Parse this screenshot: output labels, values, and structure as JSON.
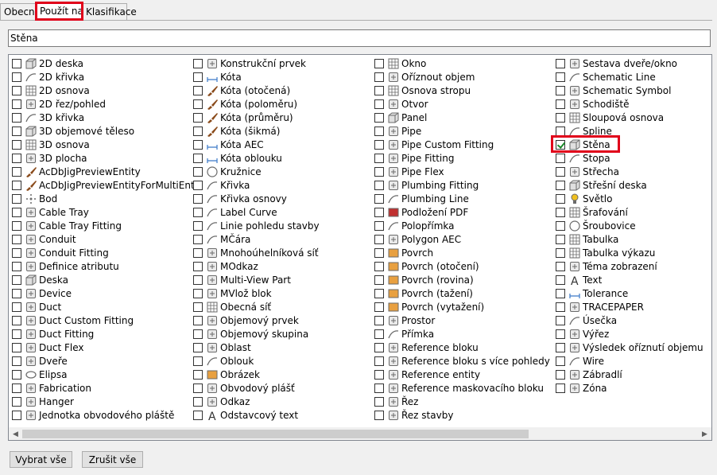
{
  "tabs": [
    {
      "label": "Obecné",
      "active": false
    },
    {
      "label": "Použít na",
      "active": true
    },
    {
      "label": "Klasifikace",
      "active": false
    }
  ],
  "name_field": {
    "value": "Stěna"
  },
  "columns": [
    [
      {
        "label": "2D deska",
        "icon": "slab-2d-icon",
        "checked": false
      },
      {
        "label": "2D křivka",
        "icon": "curve-2d-icon",
        "checked": false
      },
      {
        "label": "2D osnova",
        "icon": "grid-2d-icon",
        "checked": false
      },
      {
        "label": "2D řez/pohled",
        "icon": "section-2d-icon",
        "checked": false
      },
      {
        "label": "3D křivka",
        "icon": "curve-3d-icon",
        "checked": false
      },
      {
        "label": "3D objemové těleso",
        "icon": "solid-3d-icon",
        "checked": false
      },
      {
        "label": "3D osnova",
        "icon": "grid-3d-icon",
        "checked": false
      },
      {
        "label": "3D plocha",
        "icon": "face-3d-icon",
        "checked": false
      },
      {
        "label": "AcDbJigPreviewEntity",
        "icon": "brush-icon",
        "checked": false
      },
      {
        "label": "AcDbJigPreviewEntityForMultiEnts",
        "icon": "brush-icon",
        "checked": false
      },
      {
        "label": "Bod",
        "icon": "point-icon",
        "checked": false
      },
      {
        "label": "Cable Tray",
        "icon": "cable-tray-icon",
        "checked": false
      },
      {
        "label": "Cable Tray Fitting",
        "icon": "cable-tray-fitting-icon",
        "checked": false
      },
      {
        "label": "Conduit",
        "icon": "conduit-icon",
        "checked": false
      },
      {
        "label": "Conduit Fitting",
        "icon": "conduit-fitting-icon",
        "checked": false
      },
      {
        "label": "Definice atributu",
        "icon": "attribute-icon",
        "checked": false
      },
      {
        "label": "Deska",
        "icon": "slab-icon",
        "checked": false
      },
      {
        "label": "Device",
        "icon": "device-icon",
        "checked": false
      },
      {
        "label": "Duct",
        "icon": "duct-icon",
        "checked": false
      },
      {
        "label": "Duct Custom Fitting",
        "icon": "duct-custom-fitting-icon",
        "checked": false
      },
      {
        "label": "Duct Fitting",
        "icon": "duct-fitting-icon",
        "checked": false
      },
      {
        "label": "Duct Flex",
        "icon": "duct-flex-icon",
        "checked": false
      },
      {
        "label": "Dveře",
        "icon": "door-icon",
        "checked": false
      },
      {
        "label": "Elipsa",
        "icon": "ellipse-icon",
        "checked": false
      },
      {
        "label": "Fabrication",
        "icon": "fabrication-icon",
        "checked": false
      },
      {
        "label": "Hanger",
        "icon": "hanger-icon",
        "checked": false
      },
      {
        "label": "Jednotka obvodového pláště",
        "icon": "curtain-wall-unit-icon",
        "checked": false
      }
    ],
    [
      {
        "label": "Konstrukční prvek",
        "icon": "structural-member-icon",
        "checked": false
      },
      {
        "label": "Kóta",
        "icon": "dimension-icon",
        "checked": false
      },
      {
        "label": "Kóta (otočená)",
        "icon": "brush-icon",
        "checked": false
      },
      {
        "label": "Kóta (poloměru)",
        "icon": "brush-icon",
        "checked": false
      },
      {
        "label": "Kóta (průměru)",
        "icon": "brush-icon",
        "checked": false
      },
      {
        "label": "Kóta (šikmá)",
        "icon": "brush-icon",
        "checked": false
      },
      {
        "label": "Kóta AEC",
        "icon": "aec-dimension-icon",
        "checked": false
      },
      {
        "label": "Kóta oblouku",
        "icon": "arc-dimension-icon",
        "checked": false
      },
      {
        "label": "Kružnice",
        "icon": "circle-icon",
        "checked": false
      },
      {
        "label": "Křivka",
        "icon": "polyline-icon",
        "checked": false
      },
      {
        "label": "Křivka osnovy",
        "icon": "grid-line-icon",
        "checked": false
      },
      {
        "label": "Label Curve",
        "icon": "label-curve-icon",
        "checked": false
      },
      {
        "label": "Linie pohledu stavby",
        "icon": "building-line-icon",
        "checked": false
      },
      {
        "label": "MČára",
        "icon": "mline-icon",
        "checked": false
      },
      {
        "label": "Mnohoúhelníková síť",
        "icon": "polygon-mesh-icon",
        "checked": false
      },
      {
        "label": "MOdkaz",
        "icon": "mleader-icon",
        "checked": false
      },
      {
        "label": "Multi-View Part",
        "icon": "multi-view-part-icon",
        "checked": false
      },
      {
        "label": "MVlož blok",
        "icon": "minsert-block-icon",
        "checked": false
      },
      {
        "label": "Obecná síť",
        "icon": "mesh-icon",
        "checked": false
      },
      {
        "label": "Objemový prvek",
        "icon": "mass-element-icon",
        "checked": false
      },
      {
        "label": "Objemový skupina",
        "icon": "mass-group-icon",
        "checked": false
      },
      {
        "label": "Oblast",
        "icon": "region-icon",
        "checked": false
      },
      {
        "label": "Oblouk",
        "icon": "arc-icon",
        "checked": false
      },
      {
        "label": "Obrázek",
        "icon": "image-icon",
        "checked": false
      },
      {
        "label": "Obvodový plášť",
        "icon": "curtain-wall-icon",
        "checked": false
      },
      {
        "label": "Odkaz",
        "icon": "leader-icon",
        "checked": false
      },
      {
        "label": "Odstavcový text",
        "icon": "mtext-icon",
        "checked": false
      }
    ],
    [
      {
        "label": "Okno",
        "icon": "window-icon",
        "checked": false
      },
      {
        "label": "Oříznout objem",
        "icon": "clip-volume-icon",
        "checked": false
      },
      {
        "label": "Osnova stropu",
        "icon": "ceiling-grid-icon",
        "checked": false
      },
      {
        "label": "Otvor",
        "icon": "opening-icon",
        "checked": false
      },
      {
        "label": "Panel",
        "icon": "panel-icon",
        "checked": false
      },
      {
        "label": "Pipe",
        "icon": "pipe-icon",
        "checked": false
      },
      {
        "label": "Pipe Custom Fitting",
        "icon": "pipe-custom-fitting-icon",
        "checked": false
      },
      {
        "label": "Pipe Fitting",
        "icon": "pipe-fitting-icon",
        "checked": false
      },
      {
        "label": "Pipe Flex",
        "icon": "pipe-flex-icon",
        "checked": false
      },
      {
        "label": "Plumbing Fitting",
        "icon": "plumbing-fitting-icon",
        "checked": false
      },
      {
        "label": "Plumbing Line",
        "icon": "plumbing-line-icon",
        "checked": false
      },
      {
        "label": "Podložení PDF",
        "icon": "pdf-underlay-icon",
        "checked": false
      },
      {
        "label": "Polopřímka",
        "icon": "ray-icon",
        "checked": false
      },
      {
        "label": "Polygon AEC",
        "icon": "aec-polygon-icon",
        "checked": false
      },
      {
        "label": "Povrch",
        "icon": "surface-icon",
        "checked": false
      },
      {
        "label": "Povrch (otočení)",
        "icon": "revolved-surface-icon",
        "checked": false
      },
      {
        "label": "Povrch (rovina)",
        "icon": "planar-surface-icon",
        "checked": false
      },
      {
        "label": "Povrch (tažení)",
        "icon": "swept-surface-icon",
        "checked": false
      },
      {
        "label": "Povrch (vytažení)",
        "icon": "extruded-surface-icon",
        "checked": false
      },
      {
        "label": "Prostor",
        "icon": "space-icon",
        "checked": false
      },
      {
        "label": "Přímka",
        "icon": "xline-icon",
        "checked": false
      },
      {
        "label": "Reference bloku",
        "icon": "block-reference-icon",
        "checked": false
      },
      {
        "label": "Reference bloku s více pohledy",
        "icon": "multi-view-block-icon",
        "checked": false
      },
      {
        "label": "Reference entity",
        "icon": "entity-reference-icon",
        "checked": false
      },
      {
        "label": "Reference maskovacího bloku",
        "icon": "mask-block-icon",
        "checked": false
      },
      {
        "label": "Řez",
        "icon": "section-icon",
        "checked": false
      },
      {
        "label": "Řez stavby",
        "icon": "building-section-icon",
        "checked": false
      }
    ],
    [
      {
        "label": "Sestava dveře/okno",
        "icon": "door-window-assembly-icon",
        "checked": false
      },
      {
        "label": "Schematic Line",
        "icon": "schematic-line-icon",
        "checked": false
      },
      {
        "label": "Schematic Symbol",
        "icon": "schematic-symbol-icon",
        "checked": false
      },
      {
        "label": "Schodiště",
        "icon": "stair-icon",
        "checked": false
      },
      {
        "label": "Sloupová osnova",
        "icon": "column-grid-icon",
        "checked": false
      },
      {
        "label": "Spline",
        "icon": "spline-icon",
        "checked": false
      },
      {
        "label": "Stěna",
        "icon": "wall-icon",
        "checked": true
      },
      {
        "label": "Stopa",
        "icon": "trace-icon",
        "checked": false
      },
      {
        "label": "Střecha",
        "icon": "roof-icon",
        "checked": false
      },
      {
        "label": "Střešní deska",
        "icon": "roof-slab-icon",
        "checked": false
      },
      {
        "label": "Světlo",
        "icon": "light-icon",
        "checked": false
      },
      {
        "label": "Šrafování",
        "icon": "hatch-icon",
        "checked": false
      },
      {
        "label": "Šroubovice",
        "icon": "helix-icon",
        "checked": false
      },
      {
        "label": "Tabulka",
        "icon": "table-icon",
        "checked": false
      },
      {
        "label": "Tabulka výkazu",
        "icon": "schedule-table-icon",
        "checked": false
      },
      {
        "label": "Téma zobrazení",
        "icon": "display-theme-icon",
        "checked": false
      },
      {
        "label": "Text",
        "icon": "text-icon",
        "checked": false
      },
      {
        "label": "Tolerance",
        "icon": "tolerance-icon",
        "checked": false
      },
      {
        "label": "TRACEPAPER",
        "icon": "tracepaper-icon",
        "checked": false
      },
      {
        "label": "Úsečka",
        "icon": "line-icon",
        "checked": false
      },
      {
        "label": "Výřez",
        "icon": "viewport-icon",
        "checked": false
      },
      {
        "label": "Výsledek oříznutí objemu",
        "icon": "clip-volume-result-icon",
        "checked": false
      },
      {
        "label": "Wire",
        "icon": "wire-icon",
        "checked": false
      },
      {
        "label": "Zábradlí",
        "icon": "railing-icon",
        "checked": false
      },
      {
        "label": "Zóna",
        "icon": "zone-icon",
        "checked": false
      }
    ]
  ],
  "buttons": {
    "select_all": "Vybrat vše",
    "clear_all": "Zrušit vše"
  },
  "colors": {
    "highlight": "#e0001a",
    "checkmark": "#1a8a2a"
  }
}
